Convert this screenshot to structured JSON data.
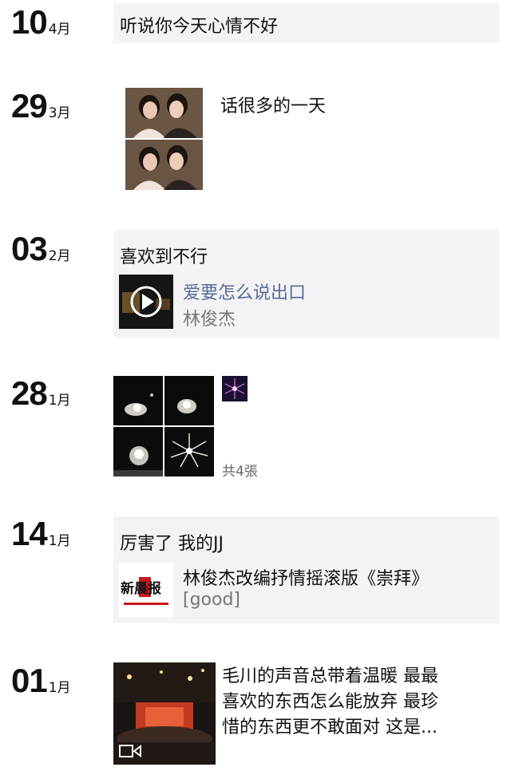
{
  "entries": [
    {
      "day": "10",
      "month": "4月",
      "text": "听说你今天心情不好"
    },
    {
      "day": "29",
      "month": "3月",
      "text": "话很多的一天"
    },
    {
      "day": "03",
      "month": "2月",
      "text": "喜欢到不行",
      "share_title": "爱要怎么说出口",
      "share_sub": "林俊杰",
      "share_icon": "play-icon"
    },
    {
      "day": "28",
      "month": "1月",
      "photo_count": "共4張"
    },
    {
      "day": "14",
      "month": "1月",
      "text": "厉害了 我的JJ",
      "share_title": "林俊杰改编抒情摇滚版《崇拜》",
      "share_sub": "[good]",
      "logo_text": "新晨报"
    },
    {
      "day": "01",
      "month": "1月",
      "lines": [
        "毛川的声音总带着温暖 最最",
        "喜欢的东西怎么能放弃 最珍",
        "惜的东西更不敢面对 这是..."
      ],
      "video_icon": "video-icon"
    }
  ],
  "colors": {
    "card_bg": "#f3f3f5",
    "link_blue": "#576b95",
    "muted": "#777777"
  }
}
